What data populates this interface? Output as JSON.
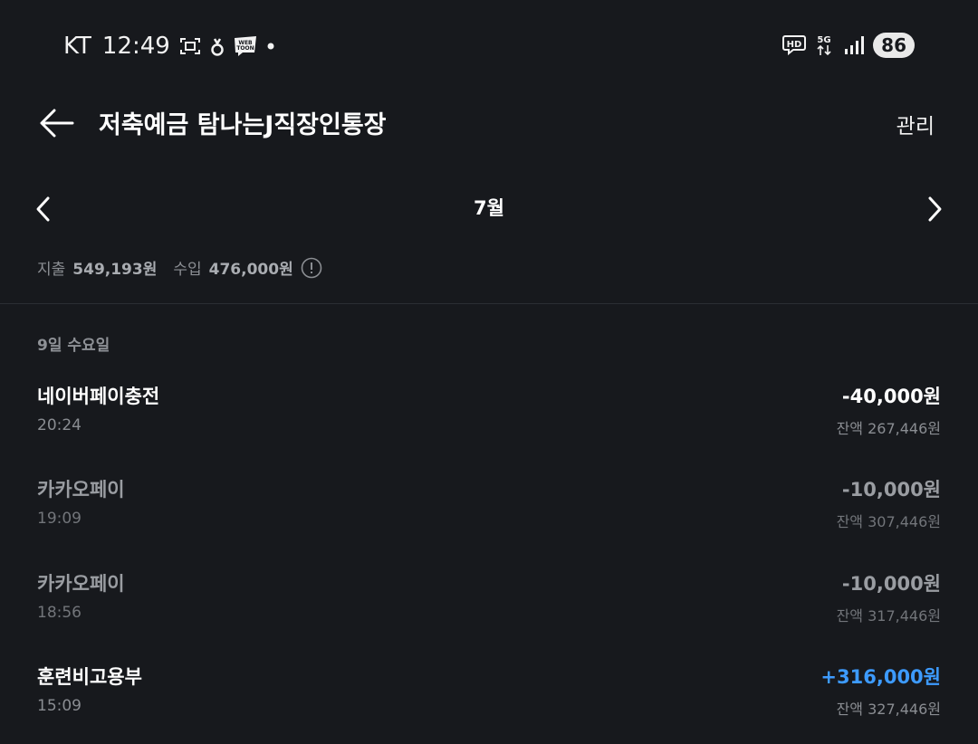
{
  "status_bar": {
    "carrier": "KT",
    "time": "12:49",
    "icons_left": [
      "screenshot-icon",
      "bean-icon",
      "webtoon-icon",
      "dot-icon"
    ],
    "webtoon_text": "WEB TOON",
    "hd_text": "HD",
    "network_text": "5G",
    "battery": "86"
  },
  "header": {
    "title": "저축예금 탐나는J직장인통장",
    "manage_label": "관리"
  },
  "month_nav": {
    "month": "7월"
  },
  "summary": {
    "expense_label": "지출",
    "expense_value": "549,193원",
    "income_label": "수입",
    "income_value": "476,000원"
  },
  "date_header": "9일 수요일",
  "transactions": [
    {
      "name": "네이버페이충전",
      "time": "20:24",
      "amount": "-40,000원",
      "balance": "잔액 267,446원"
    },
    {
      "name": "카카오페이",
      "time": "19:09",
      "amount": "-10,000원",
      "balance": "잔액 307,446원"
    },
    {
      "name": "카카오페이",
      "time": "18:56",
      "amount": "-10,000원",
      "balance": "잔액 317,446원"
    },
    {
      "name": "훈련비고용부",
      "time": "15:09",
      "amount": "+316,000원",
      "balance": "잔액 327,446원"
    }
  ],
  "colors": {
    "background": "#17191d",
    "income": "#3d9bff",
    "muted": "#8a8d92"
  }
}
